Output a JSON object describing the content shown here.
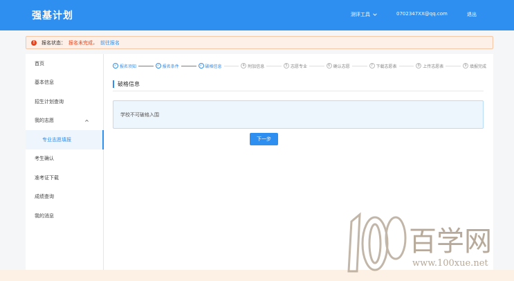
{
  "header": {
    "brand": "强基计划",
    "menu_label": "测评工具",
    "user_email": "0702347XX@qq.com",
    "logout_label": "退出"
  },
  "alert": {
    "label": "报名状态：",
    "status": "报名未完成，",
    "link": "前往报名"
  },
  "sidebar": {
    "items": [
      {
        "label": "首页"
      },
      {
        "label": "基本信息"
      },
      {
        "label": "招生计划查询"
      },
      {
        "label": "我的志愿"
      },
      {
        "label": "专业志愿填报"
      },
      {
        "label": "考生确认"
      },
      {
        "label": "准考证下载"
      },
      {
        "label": "成绩查询"
      },
      {
        "label": "我的消息"
      }
    ]
  },
  "steps": [
    {
      "num": "1",
      "label": "报名须知",
      "done": true
    },
    {
      "num": "2",
      "label": "报名条件",
      "done": true
    },
    {
      "num": "3",
      "label": "破格信息",
      "done": true
    },
    {
      "num": "4",
      "label": "附加信息",
      "done": false
    },
    {
      "num": "5",
      "label": "志愿专业",
      "done": false
    },
    {
      "num": "6",
      "label": "确认志愿",
      "done": false
    },
    {
      "num": "7",
      "label": "下载志愿表",
      "done": false
    },
    {
      "num": "8",
      "label": "上传志愿表",
      "done": false
    },
    {
      "num": "9",
      "label": "填报完成",
      "done": false
    }
  ],
  "section": {
    "title": "破格信息",
    "info_text": "学校不可破格入围"
  },
  "actions": {
    "next_label": "下一步"
  },
  "watermark": {
    "logo_text": "100",
    "cn_text": "百学网",
    "url": "www.100xue.net"
  },
  "colors": {
    "primary": "#2f8ff0",
    "alert_red": "#e8431a",
    "alert_bg": "#fdf0e8"
  }
}
